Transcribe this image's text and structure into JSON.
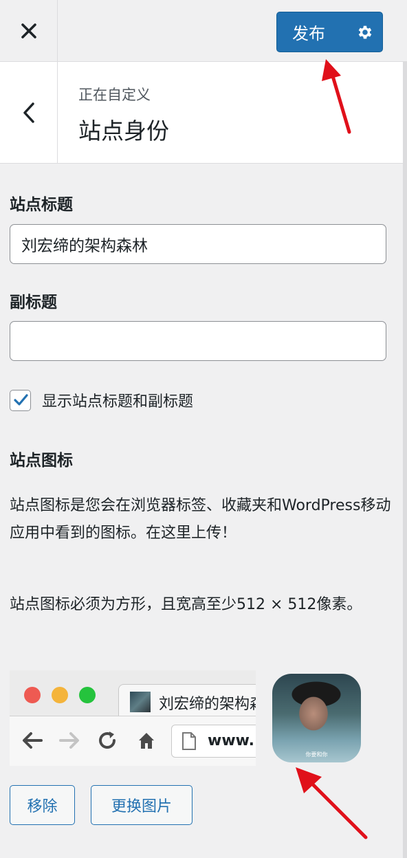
{
  "topbar": {
    "close_icon": "close-icon",
    "publish_label": "发布",
    "settings_icon": "gear-icon",
    "accent_color": "#2271b1"
  },
  "header": {
    "customizing_label": "正在自定义",
    "section_title": "站点身份"
  },
  "fields": {
    "site_title_label": "站点标题",
    "site_title_value": "刘宏缔的架构森林",
    "tagline_label": "副标题",
    "tagline_value": "",
    "display_checkbox_label": "显示站点标题和副标题",
    "display_checked": true
  },
  "site_icon": {
    "heading": "站点图标",
    "description_1": "站点图标是您会在浏览器标签、收藏夹和WordPress移动应用中看到的图标。在这里上传！",
    "description_2": "站点图标必须为方形，且宽高至少512 × 512像素。",
    "preview_tab_title": "刘宏缔的架构森林",
    "preview_url": "www.",
    "icon_caption": "你要和你"
  },
  "buttons": {
    "remove_label": "移除",
    "change_label": "更换图片"
  }
}
